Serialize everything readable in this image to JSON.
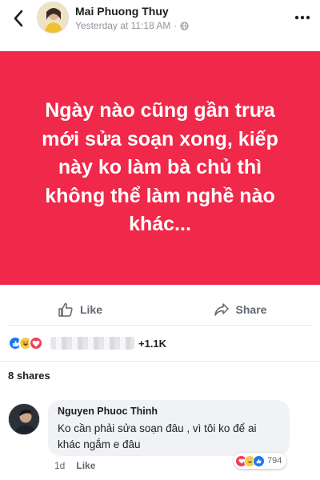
{
  "header": {
    "author_name": "Mai Phuong Thuy",
    "timestamp": "Yesterday at 11:18 AM",
    "separator": "·",
    "privacy_icon": "globe-icon",
    "back_icon": "chevron-left-icon",
    "more_icon": "more-dots-icon"
  },
  "post": {
    "text": "Ngày nào cũng gần trưa\nmới sửa soạn xong, kiếp\nnày ko làm bà chủ thì\nkhông thể làm nghề nào\nkhác...",
    "background_color": "#f02849",
    "text_color": "#ffffff"
  },
  "actions": {
    "like_label": "Like",
    "share_label": "Share"
  },
  "reactions": {
    "types": [
      "like",
      "haha",
      "love"
    ],
    "count": "+1.1K"
  },
  "shares": {
    "label": "8 shares"
  },
  "comment": {
    "author": "Nguyen Phuoc Thinh",
    "text": "Ko cần phải sửa soạn đâu , vì tôi ko để ai khác ngắm e đâu",
    "time": "1d",
    "like_label": "Like",
    "reaction_types": [
      "love",
      "haha",
      "like"
    ],
    "reaction_count": "794"
  },
  "colors": {
    "accent": "#1877f2",
    "love": "#f33e58",
    "haha": "#f7c94b"
  }
}
